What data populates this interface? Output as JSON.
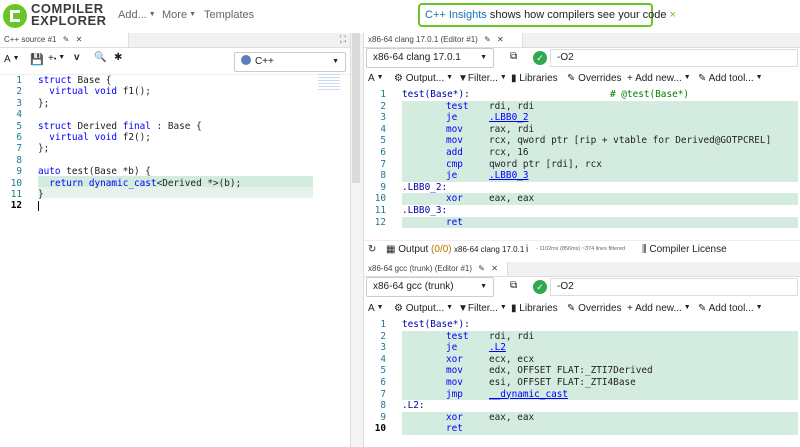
{
  "navbar": {
    "logo_line1": "COMPILER",
    "logo_line2": "EXPLORER",
    "add_label": "Add...",
    "more_label": "More",
    "templates_label": "Templates",
    "banner_link": "C++ Insights",
    "banner_text": "shows how compilers see your code",
    "banner_close": "×"
  },
  "editor": {
    "tab_title": "C++ source #1",
    "language": "C++",
    "lines": [
      "struct Base {",
      "  virtual void f1();",
      "};",
      "",
      "struct Derived final : Base {",
      "  virtual void f2();",
      "};",
      "",
      "auto test(Base *b) {",
      "  return dynamic_cast<Derived *>(b);",
      "}",
      ""
    ]
  },
  "compiler1": {
    "tab_title": "x86-64 clang 17.0.1 (Editor #1)",
    "compiler": "x86-64 clang 17.0.1",
    "options": "-O2",
    "output_label": "Output...",
    "filter_label": "Filter...",
    "libraries_label": "Libraries",
    "overrides_label": "Overrides",
    "add_new_label": "Add new...",
    "add_tool_label": "Add tool...",
    "asm": [
      {
        "label": "test(Base*):",
        "comment": "# @test(Base*)"
      },
      {
        "ins": "test",
        "ops": "rdi, rdi"
      },
      {
        "ins": "je",
        "ops": ".LBB0_2",
        "link": true
      },
      {
        "ins": "mov",
        "ops": "rax, rdi"
      },
      {
        "ins": "mov",
        "ops": "rcx, qword ptr [rip + vtable for Derived@GOTPCREL]"
      },
      {
        "ins": "add",
        "ops": "rcx, 16"
      },
      {
        "ins": "cmp",
        "ops": "qword ptr [rdi], rcx"
      },
      {
        "ins": "je",
        "ops": ".LBB0_3",
        "link": true
      },
      {
        "label": ".LBB0_2:"
      },
      {
        "ins": "xor",
        "ops": "eax, eax"
      },
      {
        "label": ".LBB0_3:"
      },
      {
        "ins": "ret",
        "ops": ""
      }
    ],
    "status": {
      "output": "Output",
      "output_count": "(0/0)",
      "compiler": "x86-64 clang 17.0.1",
      "info": "i",
      "timing": "- 1102ms (856ms) ~374 lines filtered",
      "license": "Compiler License"
    }
  },
  "compiler2": {
    "tab_title": "x86-64 gcc (trunk) (Editor #1)",
    "compiler": "x86-64 gcc (trunk)",
    "options": "-O2",
    "output_label": "Output...",
    "filter_label": "Filter...",
    "libraries_label": "Libraries",
    "overrides_label": "Overrides",
    "add_new_label": "Add new...",
    "add_tool_label": "Add tool...",
    "asm": [
      {
        "label": "test(Base*):"
      },
      {
        "ins": "test",
        "ops": "rdi, rdi"
      },
      {
        "ins": "je",
        "ops": ".L2",
        "link": true
      },
      {
        "ins": "xor",
        "ops": "ecx, ecx"
      },
      {
        "ins": "mov",
        "ops": "edx, OFFSET FLAT:_ZTI7Derived"
      },
      {
        "ins": "mov",
        "ops": "esi, OFFSET FLAT:_ZTI4Base"
      },
      {
        "ins": "jmp",
        "ops": "__dynamic_cast",
        "link": true
      },
      {
        "label": ".L2:"
      },
      {
        "ins": "xor",
        "ops": "eax, eax"
      },
      {
        "ins": "ret",
        "ops": ""
      }
    ]
  }
}
